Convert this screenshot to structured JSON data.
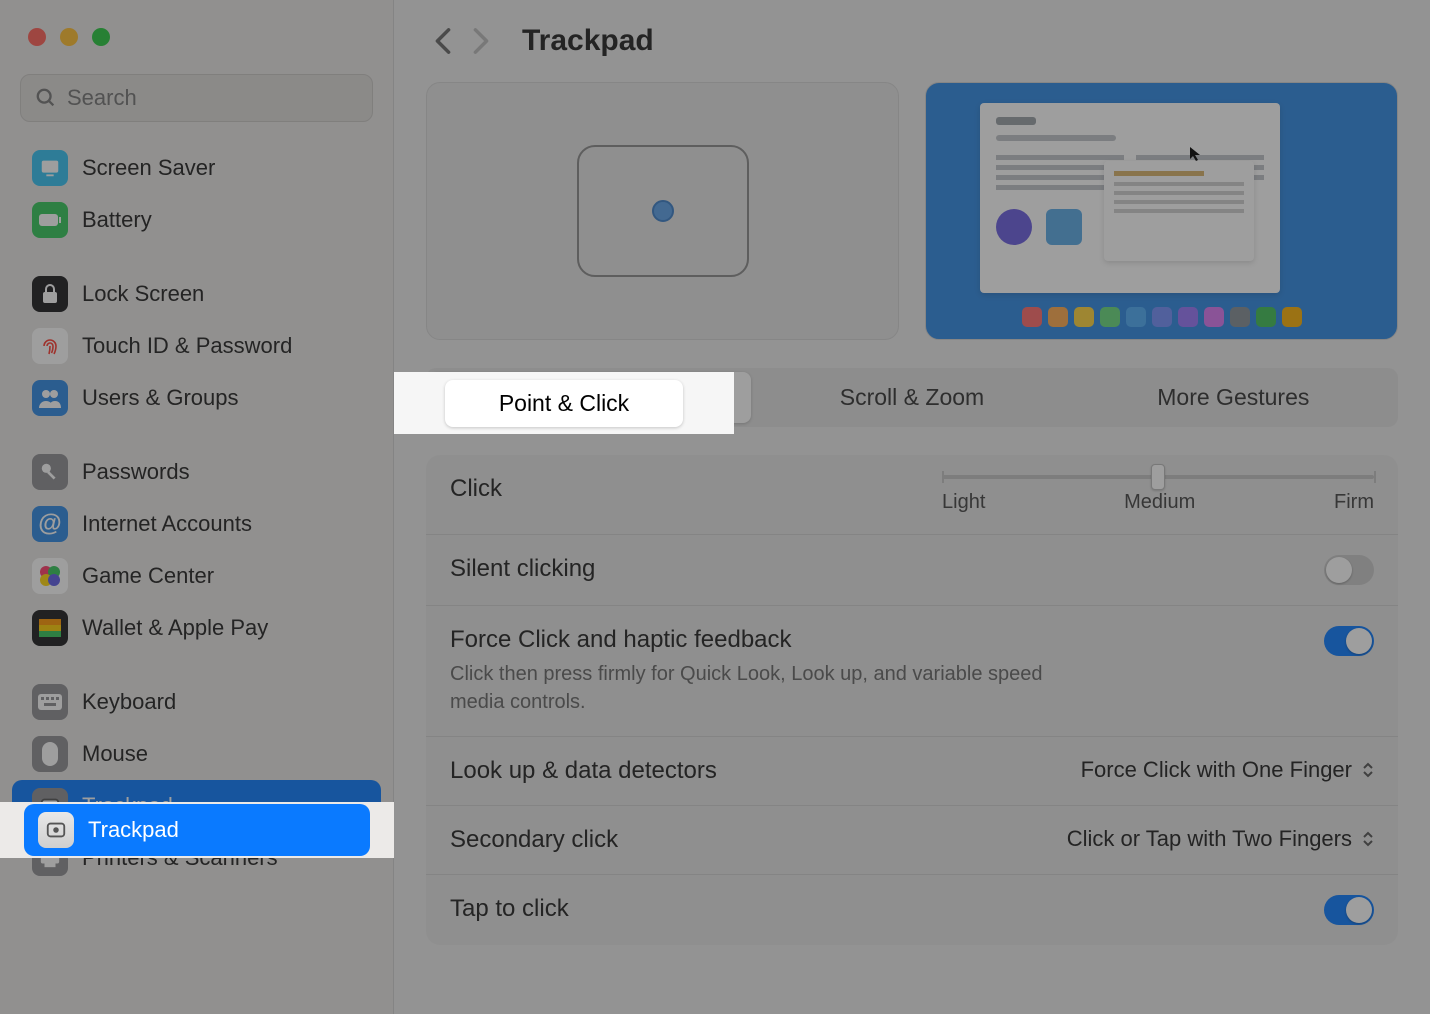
{
  "window": {
    "title": "Trackpad"
  },
  "search": {
    "placeholder": "Search"
  },
  "sidebar": {
    "items": [
      {
        "label": "Screen Saver",
        "icon": "screensaver-icon",
        "bg": "#34c2f2"
      },
      {
        "label": "Battery",
        "icon": "battery-icon",
        "bg": "#34c759"
      },
      {
        "label": "Lock Screen",
        "icon": "lock-icon",
        "bg": "#1c1c1e"
      },
      {
        "label": "Touch ID & Password",
        "icon": "fingerprint-icon",
        "bg": "#ffffff"
      },
      {
        "label": "Users & Groups",
        "icon": "users-icon",
        "bg": "#2f89e3"
      },
      {
        "label": "Passwords",
        "icon": "key-icon",
        "bg": "#8e8e93"
      },
      {
        "label": "Internet Accounts",
        "icon": "at-icon",
        "bg": "#2f89e3"
      },
      {
        "label": "Game Center",
        "icon": "gamecenter-icon",
        "bg": "#ffffff"
      },
      {
        "label": "Wallet & Apple Pay",
        "icon": "wallet-icon",
        "bg": "#1c1c1e"
      },
      {
        "label": "Keyboard",
        "icon": "keyboard-icon",
        "bg": "#8e8e93"
      },
      {
        "label": "Mouse",
        "icon": "mouse-icon",
        "bg": "#8e8e93"
      },
      {
        "label": "Trackpad",
        "icon": "trackpad-icon",
        "bg": "#8e8e93",
        "selected": true
      },
      {
        "label": "Printers & Scanners",
        "icon": "printer-icon",
        "bg": "#8e8e93"
      }
    ],
    "gaps_after": [
      1,
      4,
      8
    ]
  },
  "tabs": [
    {
      "label": "Point & Click",
      "active": true
    },
    {
      "label": "Scroll & Zoom"
    },
    {
      "label": "More Gestures"
    }
  ],
  "settings": {
    "click": {
      "label": "Click",
      "slider": {
        "min_label": "Light",
        "mid_label": "Medium",
        "max_label": "Firm",
        "value": 1,
        "ticks": 3
      }
    },
    "silent": {
      "label": "Silent clicking",
      "on": false
    },
    "force": {
      "label": "Force Click and haptic feedback",
      "sub": "Click then press firmly for Quick Look, Look up, and variable speed media controls.",
      "on": true
    },
    "lookup": {
      "label": "Look up & data detectors",
      "value": "Force Click with One Finger"
    },
    "secondary": {
      "label": "Secondary click",
      "value": "Click or Tap with Two Fingers"
    },
    "tap": {
      "label": "Tap to click",
      "on": true
    }
  },
  "highlight": {
    "tab_label": "Point & Click",
    "sidebar_label": "Trackpad"
  },
  "dock_colors": [
    "#ff6b6b",
    "#ffa94d",
    "#ffd43b",
    "#69db7c",
    "#4dabf7",
    "#748ffc",
    "#9775fa",
    "#da77f2",
    "#868e96",
    "#40c057",
    "#fab005"
  ]
}
